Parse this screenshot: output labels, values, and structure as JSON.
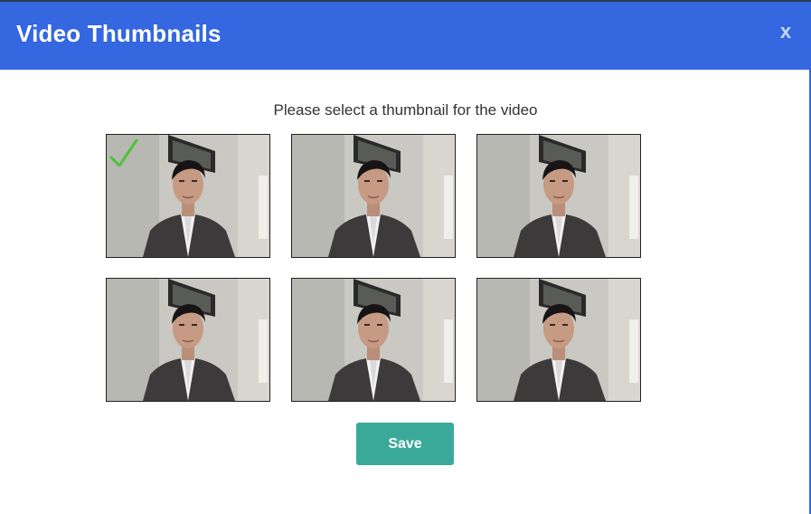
{
  "modal": {
    "title": "Video Thumbnails",
    "close_label": "x"
  },
  "prompt": "Please select a thumbnail for the video",
  "thumbnails": [
    {
      "selected": true
    },
    {
      "selected": false
    },
    {
      "selected": false
    },
    {
      "selected": false
    },
    {
      "selected": false
    },
    {
      "selected": false
    }
  ],
  "save_label": "Save",
  "colors": {
    "header": "#3467e0",
    "save_button": "#3aa99a",
    "check": "#4fc23a"
  },
  "icons": {
    "close": "close-icon",
    "selected": "checkmark-icon"
  }
}
